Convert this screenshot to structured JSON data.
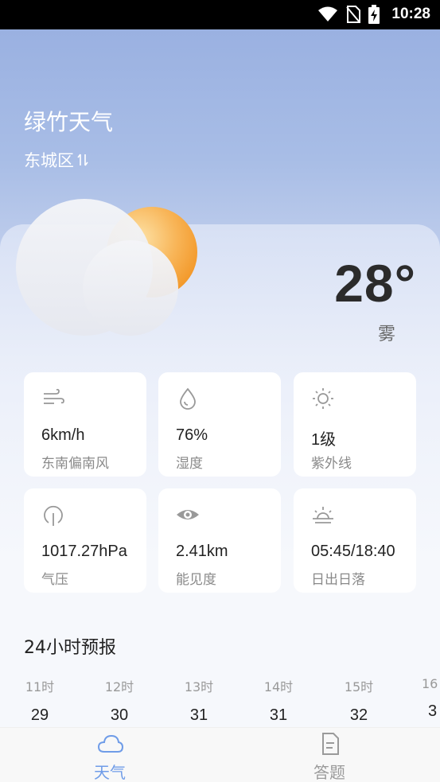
{
  "status_bar": {
    "time": "10:28",
    "icons": [
      "wifi-icon",
      "no-sim-icon",
      "battery-charging-icon"
    ]
  },
  "header": {
    "title": "绿竹天气",
    "location": "东城区",
    "location_icon": "swap-vertical-icon"
  },
  "current": {
    "temperature": "28°",
    "condition": "雾",
    "graphic": "sun-behind-cloud-icon"
  },
  "details": [
    {
      "icon": "wind-icon",
      "value": "6km/h",
      "label": "东南偏南风"
    },
    {
      "icon": "humidity-drop-icon",
      "value": "76%",
      "label": "湿度"
    },
    {
      "icon": "sun-uv-icon",
      "value": "1级",
      "label": "紫外线"
    },
    {
      "icon": "pressure-gauge-icon",
      "value": "1017.27hPa",
      "label": "气压"
    },
    {
      "icon": "eye-icon",
      "value": "2.41km",
      "label": "能见度"
    },
    {
      "icon": "sunrise-icon",
      "value": "05:45/18:40",
      "label": "日出日落"
    }
  ],
  "forecast": {
    "title": "24小时预报",
    "hours": [
      {
        "hour": "11时",
        "temp": "29"
      },
      {
        "hour": "12时",
        "temp": "30"
      },
      {
        "hour": "13时",
        "temp": "31"
      },
      {
        "hour": "14时",
        "temp": "31"
      },
      {
        "hour": "15时",
        "temp": "32"
      },
      {
        "hour": "16",
        "temp": "3"
      }
    ]
  },
  "tabbar": {
    "tabs": [
      {
        "label": "天气",
        "icon": "cloud-icon",
        "active": true
      },
      {
        "label": "答题",
        "icon": "document-icon",
        "active": false
      }
    ],
    "active_color": "#6f9ce8",
    "inactive_color": "#9a9a9a"
  },
  "colors": {
    "sun": "#f6a33a",
    "background_top": "#97aee0"
  }
}
